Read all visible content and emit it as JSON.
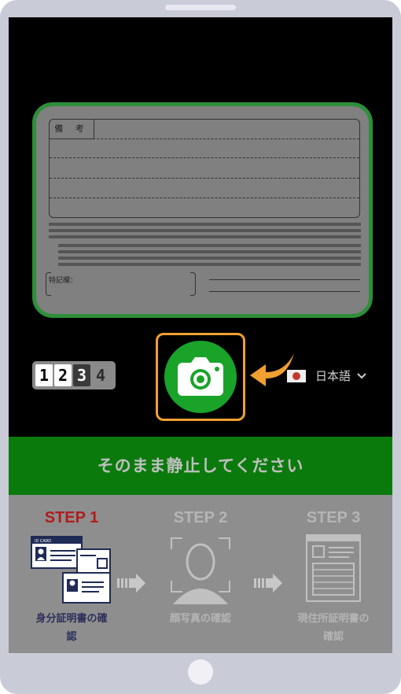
{
  "card": {
    "remarks_label": "備 考",
    "special_label": "特記欄："
  },
  "controls": {
    "counter_digits": [
      "1",
      "2",
      "3",
      "4"
    ],
    "camera_button": "camera-icon",
    "language": "日本語"
  },
  "banner": {
    "text": "そのまま静止してください"
  },
  "steps": [
    {
      "title": "STEP 1",
      "caption_line1": "身分証明書の確",
      "caption_line2": "認",
      "color": "#b01c1c"
    },
    {
      "title": "STEP 2",
      "caption_line1": "顔写真の確認",
      "caption_line2": "",
      "color": "#b5b5b5"
    },
    {
      "title": "STEP 3",
      "caption_line1": "現住所証明書の",
      "caption_line2": "確認",
      "color": "#b5b5b5"
    }
  ],
  "colors": {
    "accent_green": "#1aa329",
    "banner_green": "#0b7a0d",
    "highlight_orange": "#f0a030",
    "active_step_red": "#b01c1c"
  }
}
